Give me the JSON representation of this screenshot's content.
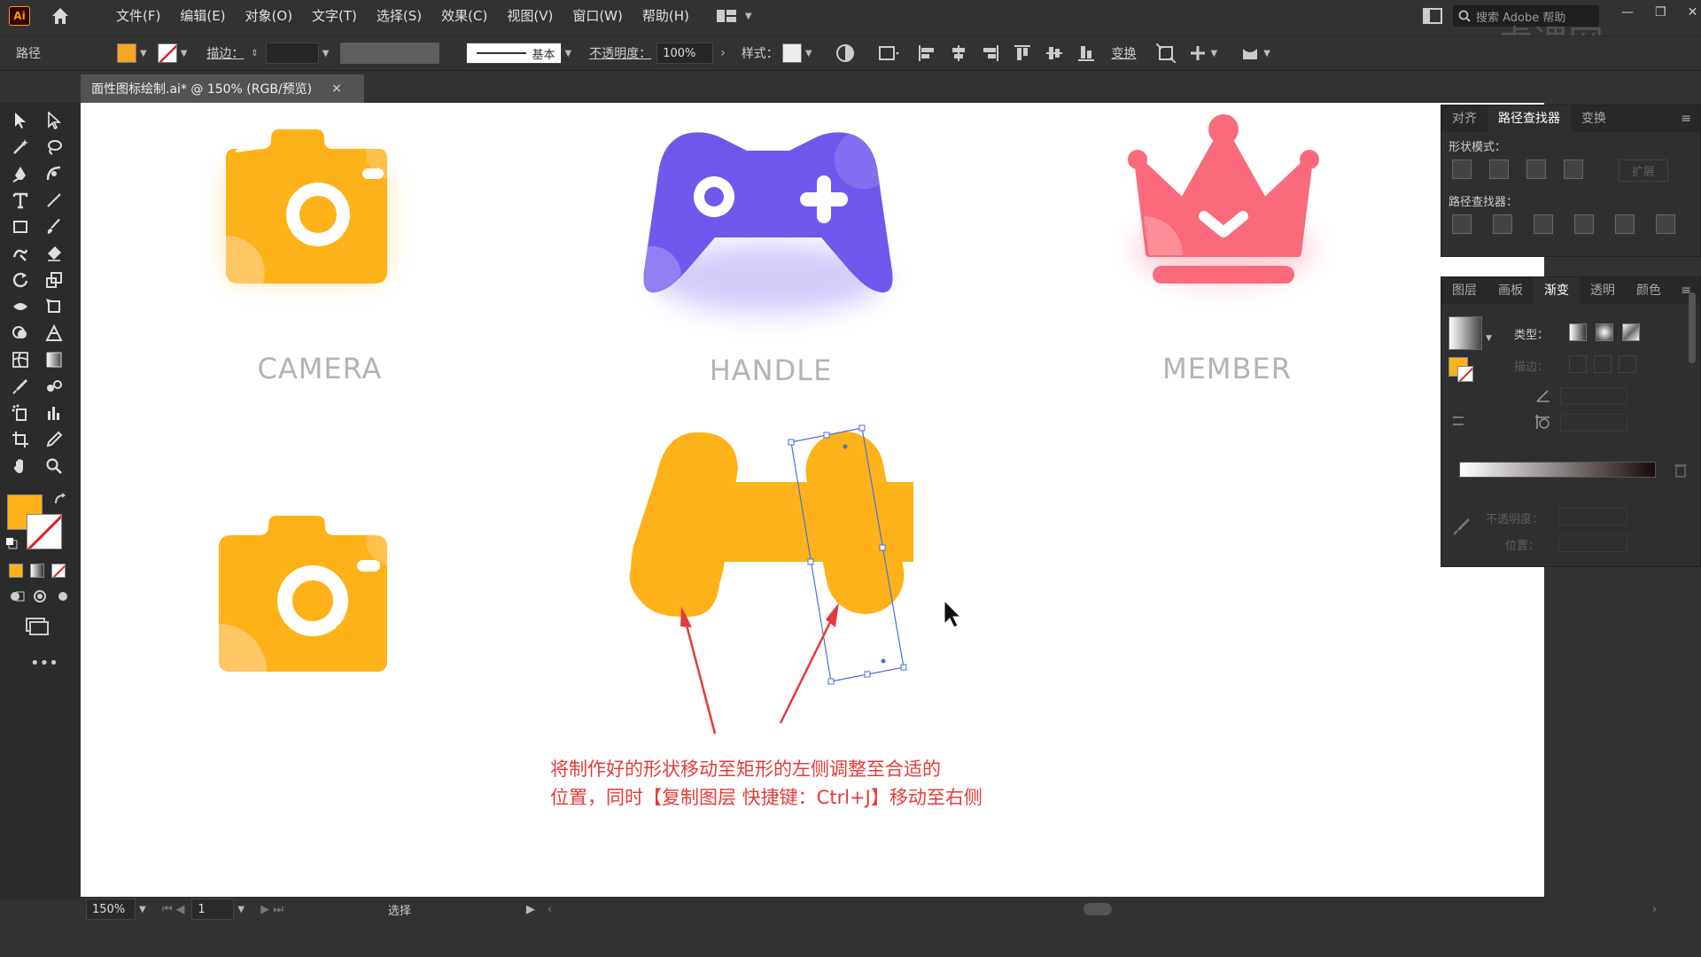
{
  "app": {
    "logo": "Ai",
    "menu": [
      "文件(F)",
      "编辑(E)",
      "对象(O)",
      "文字(T)",
      "选择(S)",
      "效果(C)",
      "视图(V)",
      "窗口(W)",
      "帮助(H)"
    ],
    "search_placeholder": "搜索 Adobe 帮助",
    "watermark": "虎课网"
  },
  "control_bar": {
    "selection_type": "路径",
    "fill_color": "#f5a623",
    "stroke_label": "描边：",
    "stroke_style": "基本",
    "opacity_label": "不透明度：",
    "opacity_value": "100%",
    "style_label": "样式：",
    "transform_label": "变换"
  },
  "document_tab": {
    "title": "面性图标绘制.ai* @ 150% (RGB/预览)",
    "close": "×"
  },
  "canvas": {
    "labels": {
      "camera": "CAMERA",
      "handle": "HANDLE",
      "member": "MEMBER"
    },
    "annotation_line1": "将制作好的形状移动至矩形的左侧调整至合适的",
    "annotation_line2": "位置，同时【复制图层 快捷键：Ctrl+J】移动至右侧",
    "colors": {
      "orange": "#fdb219",
      "purple": "#6e59ec",
      "pink": "#fa6a7b",
      "annotation": "#e53a3a",
      "selection": "#4a6fd8"
    }
  },
  "status_bar": {
    "zoom": "150%",
    "artboard": "1",
    "tool": "选择"
  },
  "panels": {
    "pathfinder": {
      "tabs": [
        "对齐",
        "路径查找器",
        "变换"
      ],
      "active_tab": "路径查找器",
      "shape_modes_label": "形状模式：",
      "pathfinders_label": "路径查找器：",
      "expand_label": "扩展"
    },
    "gradient": {
      "tabs": [
        "图层",
        "画板",
        "渐变",
        "透明",
        "颜色"
      ],
      "active_tab": "渐变",
      "type_label": "类型：",
      "stroke_label": "描边：",
      "opacity_label": "不透明度：",
      "location_label": "位置："
    }
  }
}
